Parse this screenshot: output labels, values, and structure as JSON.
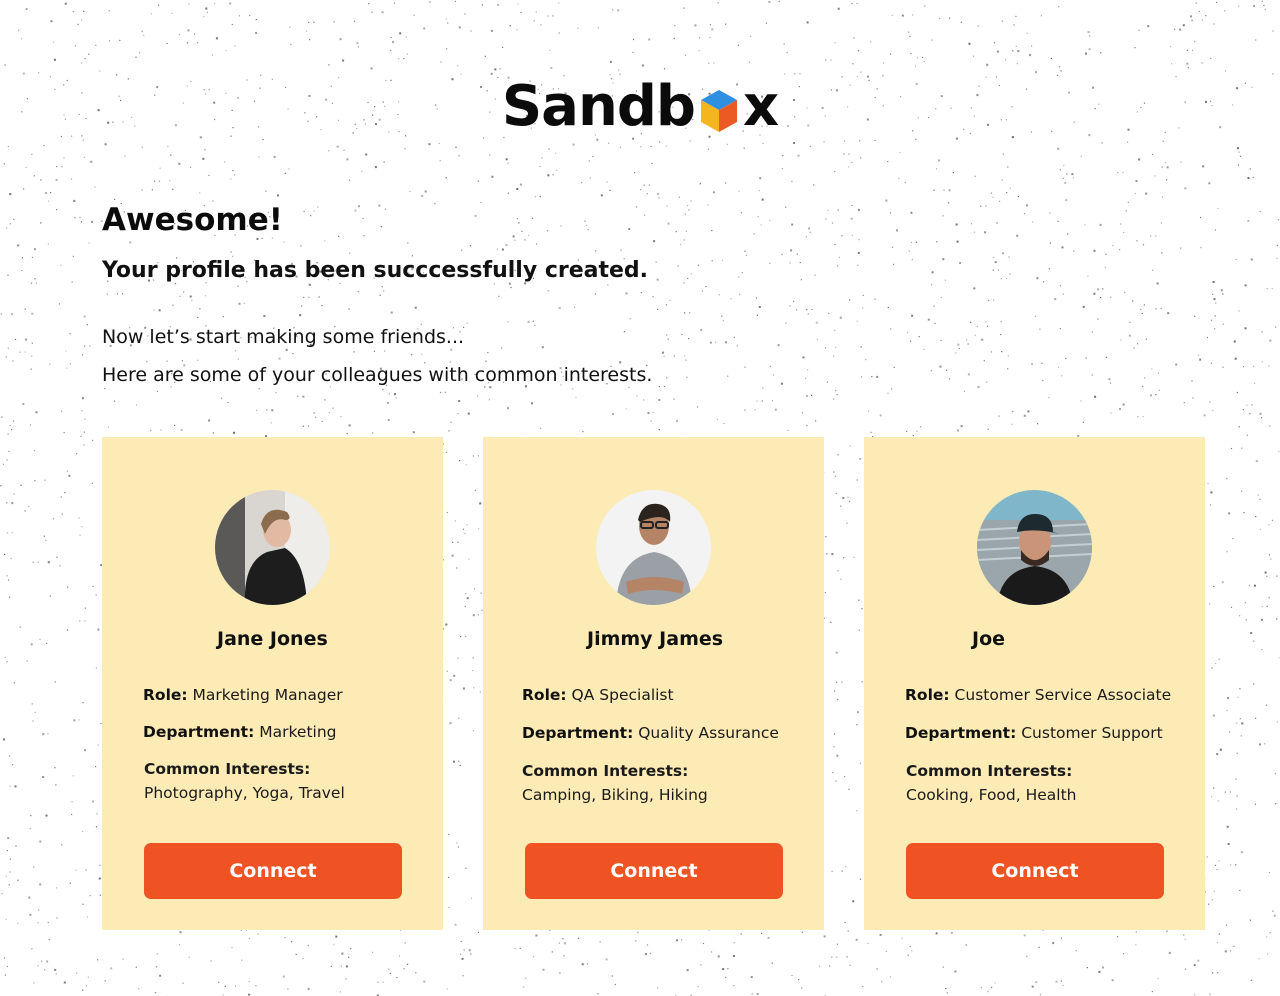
{
  "logo": {
    "text_before": "Sandb",
    "text_after": "x"
  },
  "heading": "Awesome!",
  "subheading": "Your profile has been succcessfully created.",
  "intro_line1": "Now let’s start making some friends...",
  "intro_line2": "Here are some of your colleagues with common interests.",
  "labels": {
    "role": "Role:",
    "department": "Department:",
    "interests": "Common Interests:"
  },
  "cards": [
    {
      "name": "Jane Jones",
      "role": "Marketing Manager",
      "department": "Marketing",
      "interests": "Photography, Yoga, Travel",
      "button": "Connect"
    },
    {
      "name": "Jimmy James",
      "role": "QA Specialist",
      "department": "Quality Assurance",
      "interests": "Camping, Biking, Hiking",
      "button": "Connect"
    },
    {
      "name": "Joe",
      "role": "Customer Service Associate",
      "department": "Customer Support",
      "interests": "Cooking, Food, Health",
      "button": "Connect"
    }
  ],
  "colors": {
    "card_bg": "#fdebb6",
    "button": "#f05323",
    "cube_top": "#2f8fe0",
    "cube_left": "#f5b51c",
    "cube_right": "#ec5a24"
  }
}
